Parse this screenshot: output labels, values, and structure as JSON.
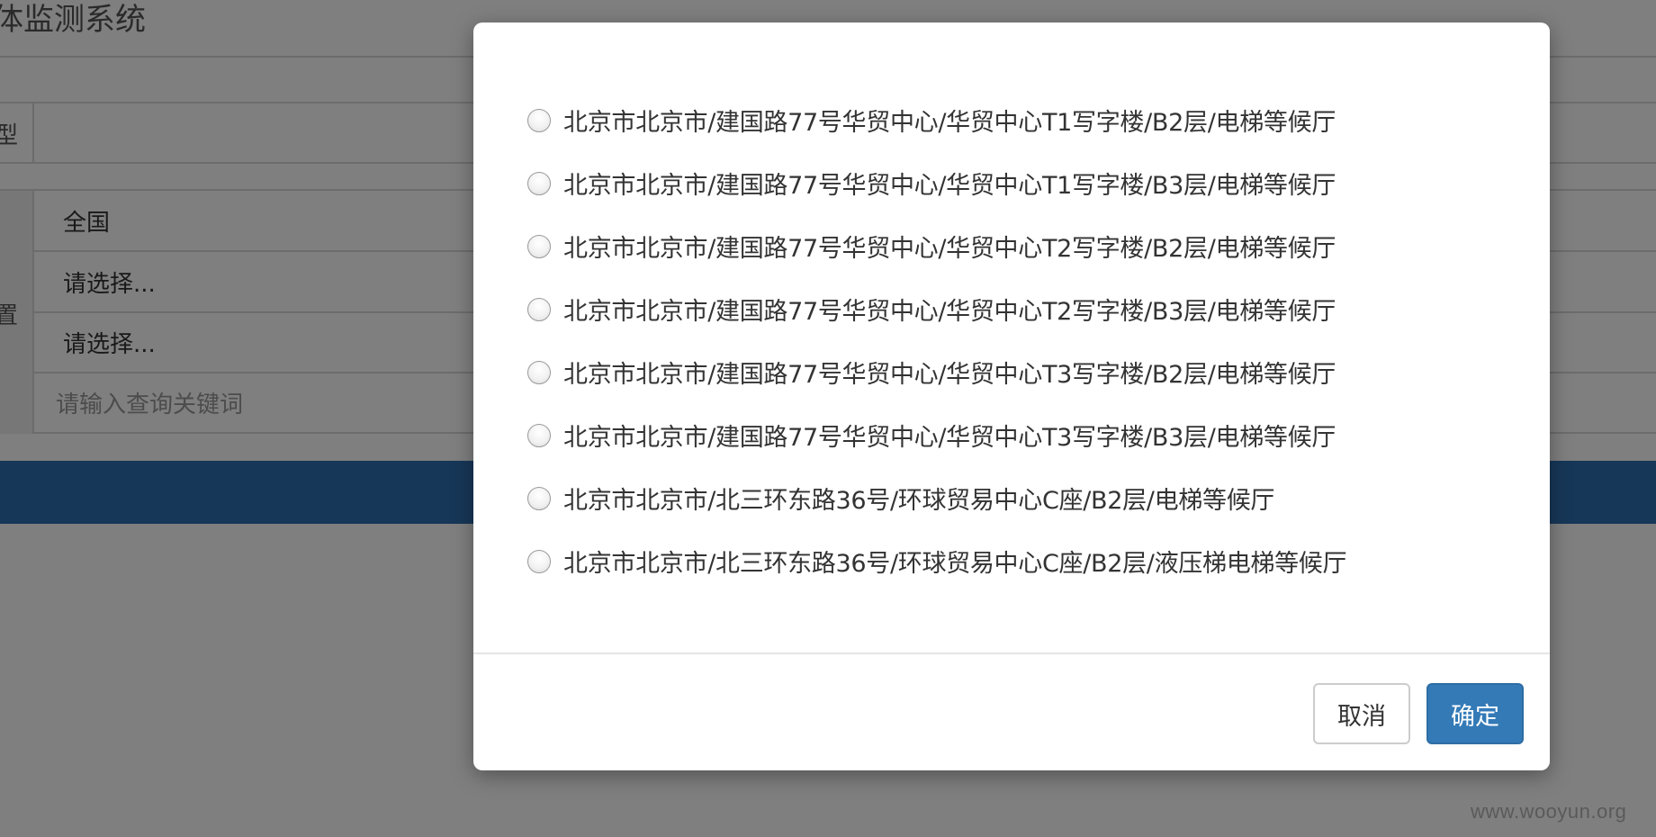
{
  "background": {
    "title": "体监测系统",
    "row_label_type": "型",
    "row_label_location": "置",
    "fields": [
      "全国",
      "请选择...",
      "请选择..."
    ],
    "search_placeholder": "请输入查询关键词"
  },
  "dialog": {
    "options": [
      "北京市北京市/建国路77号华贸中心/华贸中心T1写字楼/B2层/电梯等候厅",
      "北京市北京市/建国路77号华贸中心/华贸中心T1写字楼/B3层/电梯等候厅",
      "北京市北京市/建国路77号华贸中心/华贸中心T2写字楼/B2层/电梯等候厅",
      "北京市北京市/建国路77号华贸中心/华贸中心T2写字楼/B3层/电梯等候厅",
      "北京市北京市/建国路77号华贸中心/华贸中心T3写字楼/B2层/电梯等候厅",
      "北京市北京市/建国路77号华贸中心/华贸中心T3写字楼/B3层/电梯等候厅",
      "北京市北京市/北三环东路36号/环球贸易中心C座/B2层/电梯等候厅",
      "北京市北京市/北三环东路36号/环球贸易中心C座/B2层/液压梯电梯等候厅"
    ],
    "cancel_label": "取消",
    "confirm_label": "确定"
  },
  "watermark": "www.wooyun.org",
  "colors": {
    "overlay": "rgba(0,0,0,0.5)",
    "primary": "#337ab7",
    "header_bar": "#2f6fb0"
  }
}
